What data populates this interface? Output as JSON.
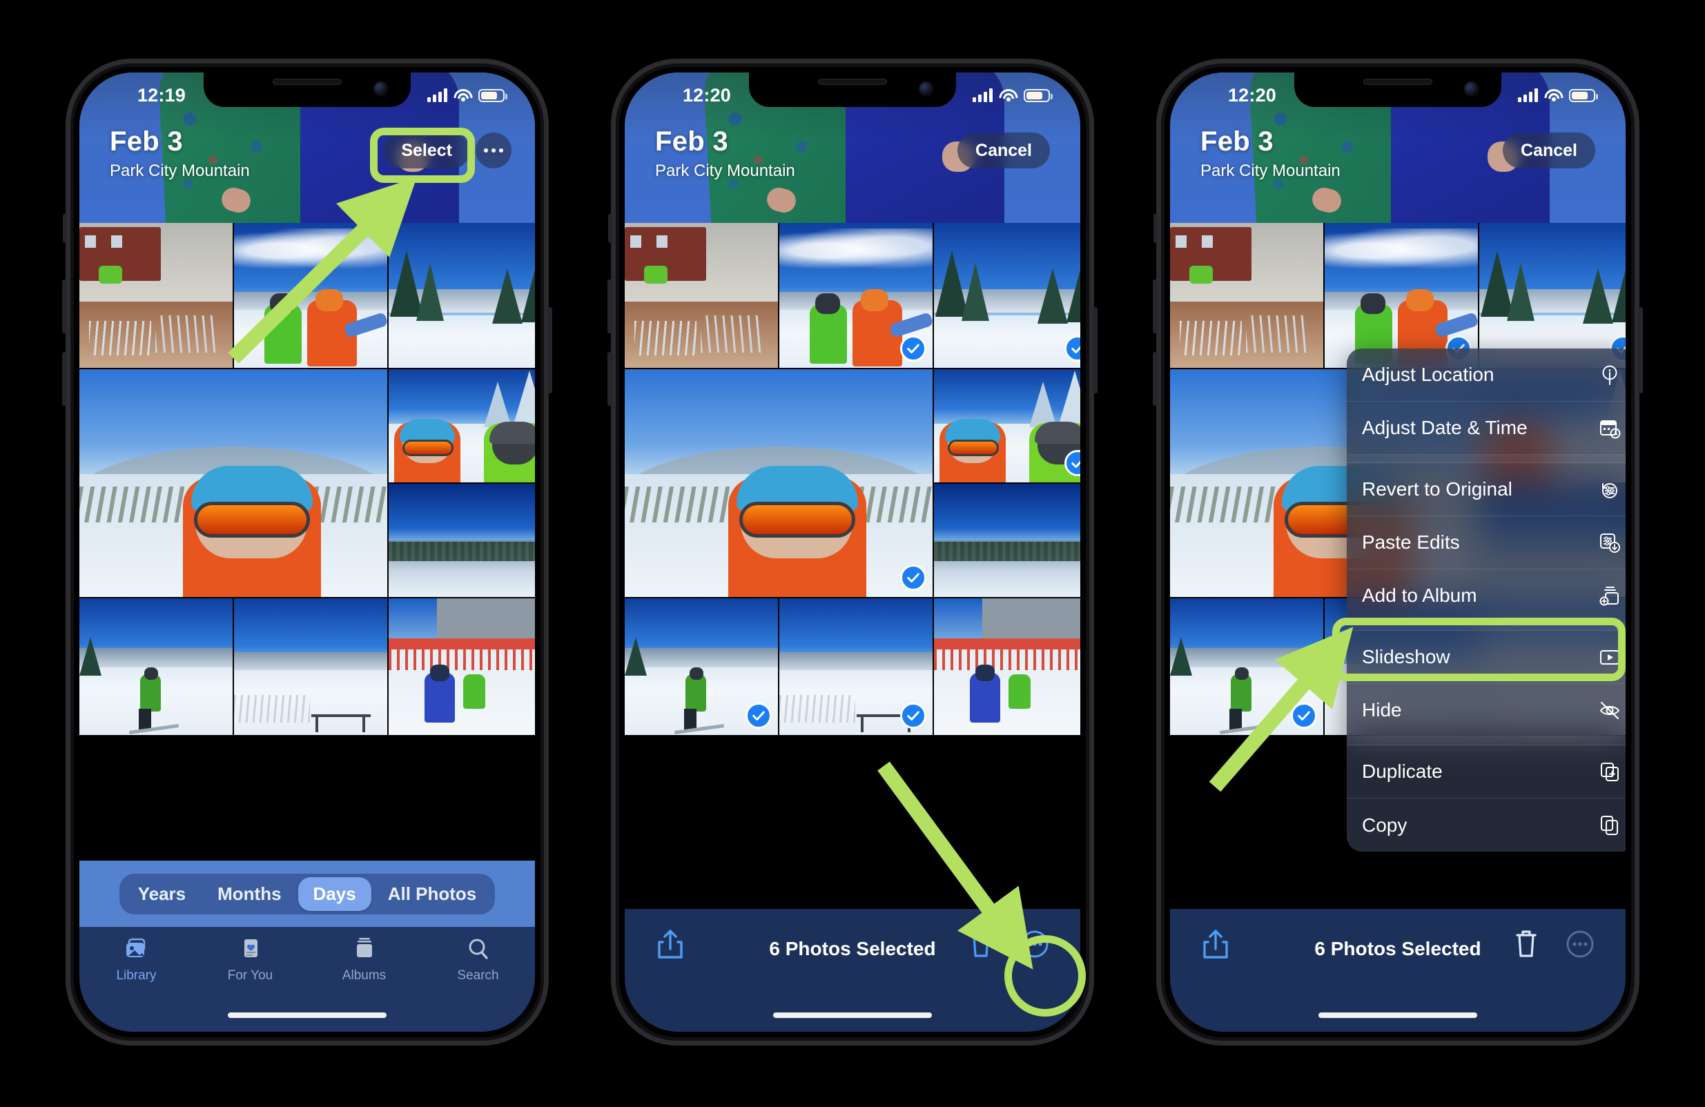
{
  "accent": {
    "highlight_green": "#b3e060",
    "ios_blue": "#1b7ef3",
    "selected_tab": "#79a7f2"
  },
  "phones": [
    {
      "id": "phone-1-library",
      "status_bar": {
        "time": "12:19",
        "signal_icon": "cellular-bars-icon",
        "wifi_icon": "wifi-icon",
        "battery_icon": "battery-icon"
      },
      "nav": {
        "title": "Feb 3",
        "subtitle": "Park City Mountain",
        "primary_button": "Select",
        "more_button_icon": "ellipsis-icon"
      },
      "segmented_control": {
        "options": [
          "Years",
          "Months",
          "Days",
          "All Photos"
        ],
        "selected": "Days"
      },
      "tab_bar": {
        "items": [
          {
            "label": "Library",
            "icon": "photos-library-icon",
            "active": true
          },
          {
            "label": "For You",
            "icon": "for-you-icon",
            "active": false
          },
          {
            "label": "Albums",
            "icon": "albums-icon",
            "active": false
          },
          {
            "label": "Search",
            "icon": "search-icon",
            "active": false
          }
        ]
      },
      "annotations": [
        {
          "type": "rounded-rect-highlight",
          "target": "Select"
        },
        {
          "type": "arrow",
          "direction": "up-right",
          "points_to": "Select"
        }
      ]
    },
    {
      "id": "phone-2-selection",
      "status_bar": {
        "time": "12:20",
        "signal_icon": "cellular-bars-icon",
        "wifi_icon": "wifi-icon",
        "battery_icon": "battery-icon"
      },
      "nav": {
        "title": "Feb 3",
        "subtitle": "Park City Mountain",
        "primary_button": "Cancel"
      },
      "toolbar": {
        "share_icon": "share-icon",
        "count_label": "6 Photos Selected",
        "trash_icon": "trash-icon",
        "more_icon": "ellipsis-circle-icon"
      },
      "selected_photo_indices": [
        1,
        2,
        4,
        6,
        7,
        8
      ],
      "annotations": [
        {
          "type": "circle-highlight",
          "target": "ellipsis-circle-icon"
        },
        {
          "type": "arrow",
          "direction": "down-right",
          "points_to": "ellipsis-circle-icon"
        }
      ]
    },
    {
      "id": "phone-3-context-menu",
      "status_bar": {
        "time": "12:20",
        "signal_icon": "cellular-bars-icon",
        "wifi_icon": "wifi-icon",
        "battery_icon": "battery-icon"
      },
      "nav": {
        "title": "Feb 3",
        "subtitle": "Park City Mountain",
        "primary_button": "Cancel"
      },
      "toolbar": {
        "share_icon": "share-icon",
        "count_label": "6 Photos Selected",
        "trash_icon": "trash-icon",
        "more_icon": "ellipsis-circle-icon"
      },
      "selected_photo_indices": [
        1,
        2,
        4,
        6
      ],
      "context_menu": {
        "items": [
          {
            "label": "Adjust Location",
            "icon": "location-info-icon",
            "highlighted": false
          },
          {
            "label": "Adjust Date & Time",
            "icon": "calendar-clock-icon",
            "highlighted": false
          },
          {
            "label": "Revert to Original",
            "icon": "revert-sliders-icon",
            "highlighted": false
          },
          {
            "label": "Paste Edits",
            "icon": "paste-edits-icon",
            "highlighted": true
          },
          {
            "label": "Add to Album",
            "icon": "add-to-album-icon",
            "highlighted": false
          },
          {
            "label": "Slideshow",
            "icon": "slideshow-play-icon",
            "highlighted": false
          },
          {
            "label": "Hide",
            "icon": "eye-slash-icon",
            "highlighted": false
          },
          {
            "label": "Duplicate",
            "icon": "duplicate-icon",
            "highlighted": false
          },
          {
            "label": "Copy",
            "icon": "copy-icon",
            "highlighted": false
          }
        ]
      },
      "annotations": [
        {
          "type": "rounded-rect-highlight",
          "target": "Paste Edits"
        },
        {
          "type": "arrow",
          "direction": "up-right",
          "points_to": "Paste Edits"
        }
      ]
    }
  ]
}
